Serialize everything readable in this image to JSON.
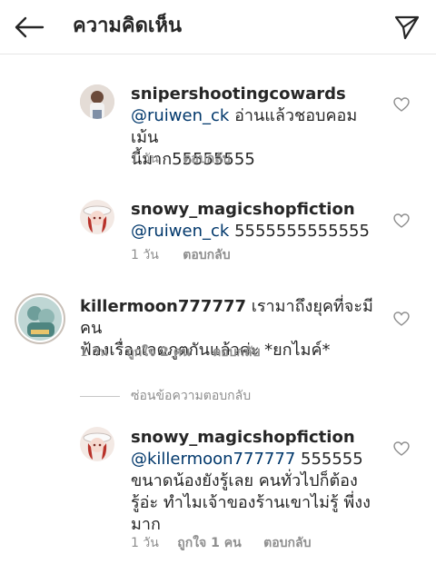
{
  "header": {
    "title": "ความคิดเห็น",
    "back_icon": "arrow-left-icon",
    "share_icon": "paper-plane-icon"
  },
  "colors": {
    "mention": "#00376b",
    "meta": "#8e8e8e",
    "divider": "#e6e6e6"
  },
  "comments": [
    {
      "username": "snipershootingcowards",
      "mention": "@ruiwen_ck",
      "text_line1": " อ่านแล้วชอบคอมเม้น",
      "text_line2": "นี้มาก55555555",
      "time": "1 วัน",
      "reply": "ตอบกลับ"
    },
    {
      "username": "snowy_magicshopfiction",
      "mention": "@ruiwen_ck",
      "text_line1": " 5555555555555",
      "time": "1 วัน",
      "reply": "ตอบกลับ"
    },
    {
      "username": "killermoon777777",
      "text_line1": " เรามาถึงยุคที่จะมีคน",
      "text_line2": "ฟ้องเรื่องเจตภูตกันแล้วค่ะ *ยกไมค์*",
      "time": "1 วัน",
      "likes": "ถูกใจ 2 คน",
      "reply": "ตอบกลับ"
    },
    {
      "username": "snowy_magicshopfiction",
      "mention": "@killermoon777777",
      "text_line1": " 555555",
      "text_line2": "ขนาดน้องยังรู้เลย คนทั่วไปก็ต้อง",
      "text_line3": "รู้อ่ะ ทำไมเจ้าของร้านเขาไม่รู้ พี่งง",
      "text_line4": "มาก",
      "time": "1 วัน",
      "likes": "ถูกใจ 1 คน",
      "reply": "ตอบกลับ"
    }
  ],
  "hide_replies": "ซ่อนข้อความตอบกลับ"
}
